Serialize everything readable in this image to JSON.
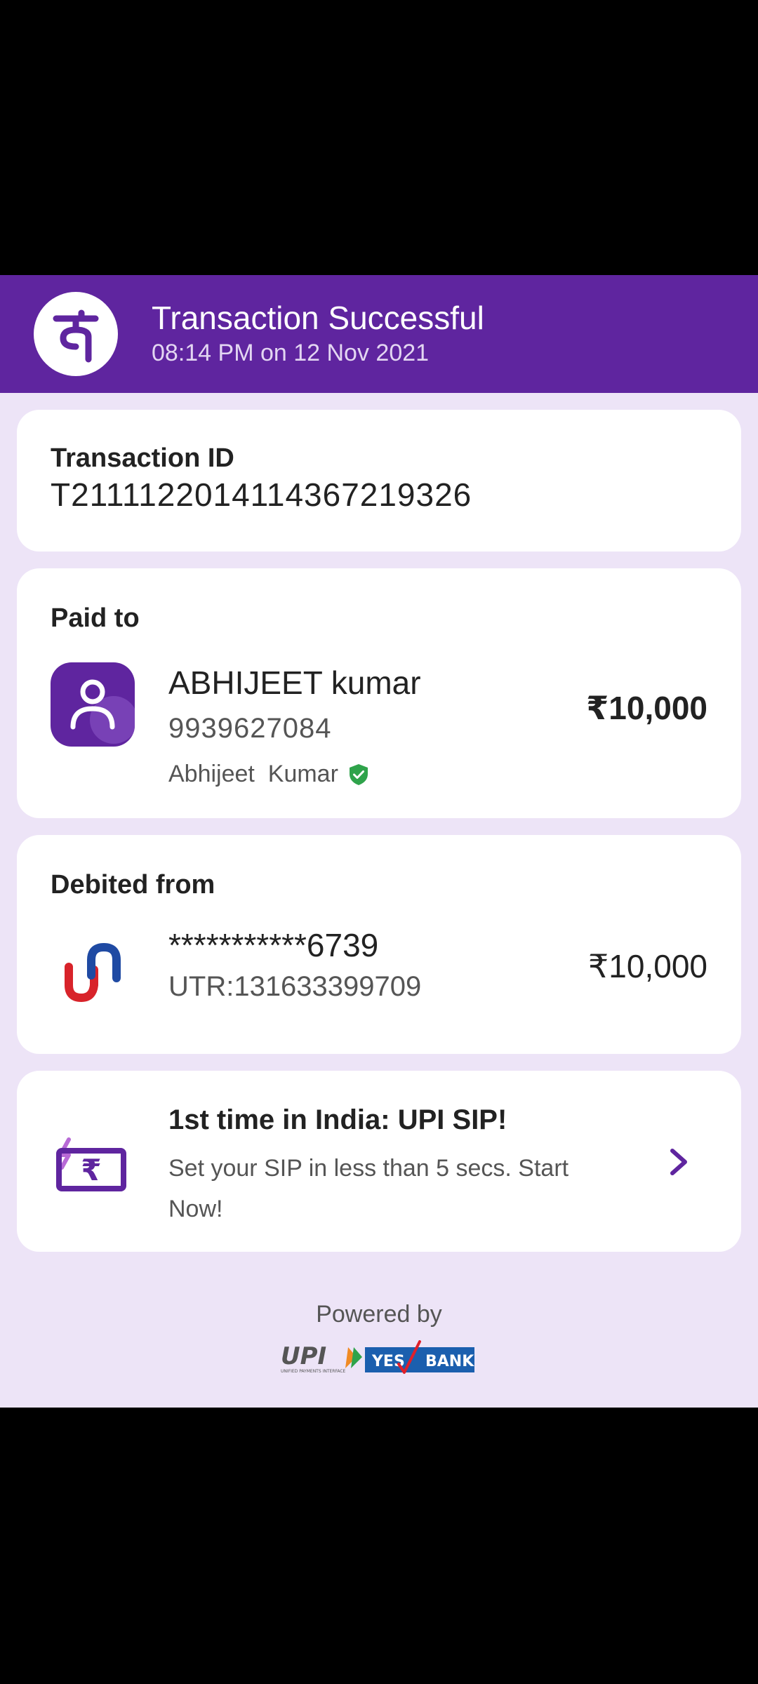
{
  "header": {
    "title": "Transaction Successful",
    "datetime": "08:14 PM on 12 Nov 2021",
    "logo_icon": "phonepe-logo-icon",
    "color": "#5f259f"
  },
  "transaction": {
    "label": "Transaction ID",
    "id": "T2111122014114367219326"
  },
  "paid_to": {
    "label": "Paid to",
    "name": "ABHIJEET kumar",
    "phone": "9939627084",
    "verified_name": "Abhijeet  Kumar",
    "verified_icon": "verified-shield-icon",
    "amount": "₹10,000"
  },
  "debited_from": {
    "label": "Debited from",
    "account": "***********6739",
    "utr": "UTR:131633399709",
    "amount": "₹10,000",
    "bank_icon": "union-bank-logo-icon"
  },
  "promo": {
    "title": "1st time in India: UPI SIP!",
    "description": "Set your SIP in less than 5 secs. Start Now!",
    "icon": "rupee-sip-icon",
    "chevron_icon": "chevron-right-icon"
  },
  "footer": {
    "powered_by": "Powered by",
    "upi_text": "UPI",
    "upi_subtext": "UNIFIED PAYMENTS INTERFACE",
    "bank_text_1": "YES",
    "bank_text_2": "BANK"
  }
}
